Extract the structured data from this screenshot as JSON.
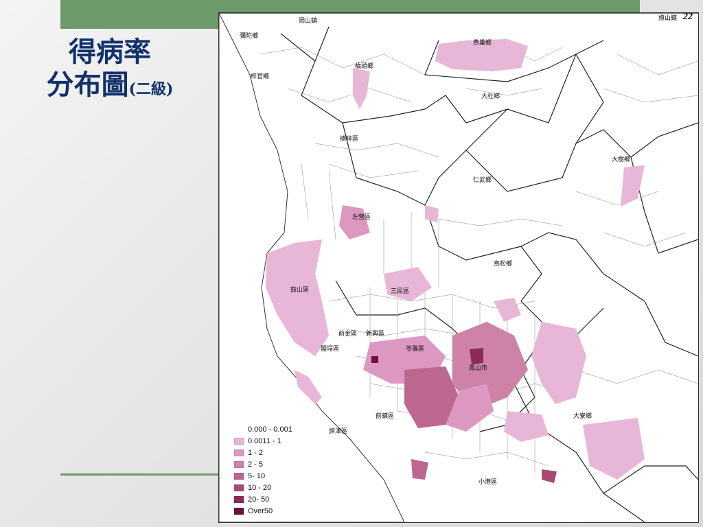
{
  "slide": {
    "title_line1": "得病率",
    "title_line2": "分布圖",
    "title_suffix": "(二級)",
    "page_number": "22"
  },
  "map": {
    "places": [
      {
        "id": "gangshan",
        "label": "岡山鎮"
      },
      {
        "id": "qishan",
        "label": "旗山鎮"
      },
      {
        "id": "mituo",
        "label": "彌陀鄉"
      },
      {
        "id": "yanchao",
        "label": "燕巢鄉"
      },
      {
        "id": "qiaotou",
        "label": "橋頭鄉"
      },
      {
        "id": "ziguan",
        "label": "梓官鄉"
      },
      {
        "id": "dashe",
        "label": "大社鄉"
      },
      {
        "id": "nanzi",
        "label": "楠梓區"
      },
      {
        "id": "dashu",
        "label": "大樹鄉"
      },
      {
        "id": "renwu",
        "label": "仁武鄉"
      },
      {
        "id": "zuoying",
        "label": "左營區"
      },
      {
        "id": "niaosong",
        "label": "鳥松鄉"
      },
      {
        "id": "gushan",
        "label": "鼓山區"
      },
      {
        "id": "sanmin",
        "label": "三民區"
      },
      {
        "id": "qianjin",
        "label": "前金區"
      },
      {
        "id": "xinxing",
        "label": "新興區"
      },
      {
        "id": "yancheng",
        "label": "鹽埕區"
      },
      {
        "id": "lingya",
        "label": "苓雅區"
      },
      {
        "id": "fengshan",
        "label": "鳳山市"
      },
      {
        "id": "qianzhen",
        "label": "前鎮區"
      },
      {
        "id": "daliao",
        "label": "大寮鄉"
      },
      {
        "id": "cijin",
        "label": "旗津區"
      },
      {
        "id": "xiaogang",
        "label": "小港區"
      }
    ],
    "legend": [
      {
        "label": "0.000 - 0.001",
        "color": "#ffffff"
      },
      {
        "label": "0.0011 - 1",
        "color": "#e8b6d6"
      },
      {
        "label": "1 - 2",
        "color": "#dc98c0"
      },
      {
        "label": "2 - 5",
        "color": "#cf82a8"
      },
      {
        "label": "5- 10",
        "color": "#bd6690"
      },
      {
        "label": "10 - 20",
        "color": "#a84a74"
      },
      {
        "label": "20- 50",
        "color": "#8e2a58"
      },
      {
        "label": "Over50",
        "color": "#6e0e3c"
      }
    ]
  }
}
